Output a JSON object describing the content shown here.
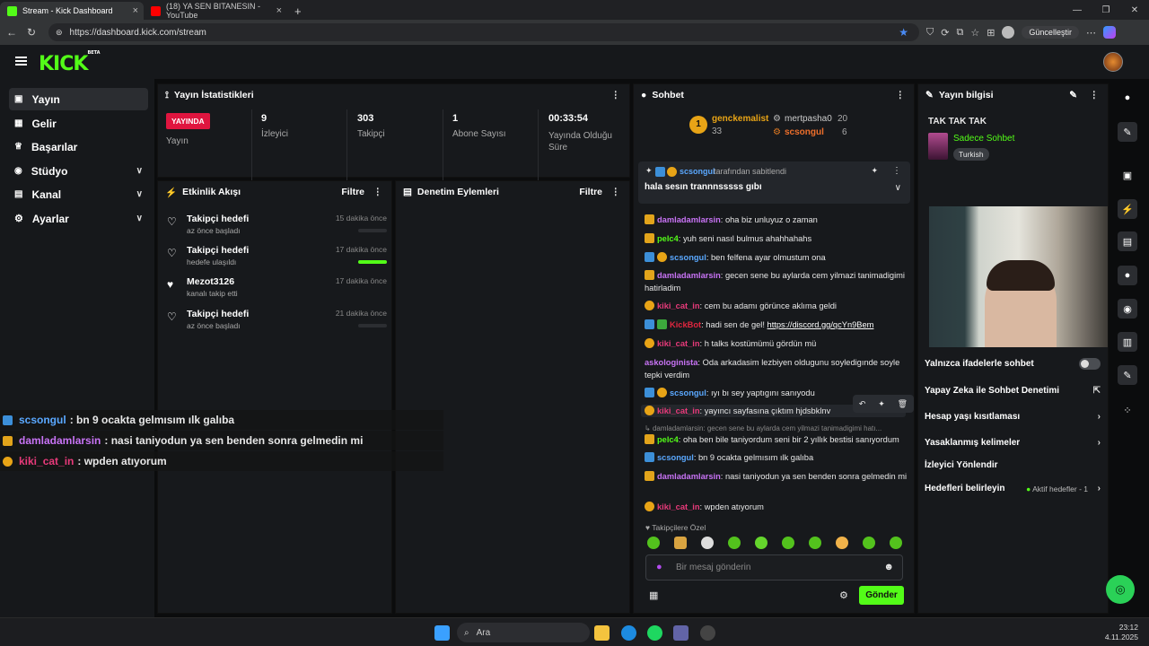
{
  "browser": {
    "tabs": [
      {
        "title": "Stream - Kick Dashboard"
      },
      {
        "title": "(18) YA SEN BITANESIN - YouTube"
      }
    ],
    "url": "https://dashboard.kick.com/stream",
    "update_label": "Güncelleştir"
  },
  "app": {
    "logo": "KICK",
    "logo_badge": "BETA"
  },
  "sidebar": {
    "items": [
      {
        "label": "Yayın",
        "icon": "broadcast-icon"
      },
      {
        "label": "Gelir",
        "icon": "revenue-icon"
      },
      {
        "label": "Başarılar",
        "icon": "trophy-icon"
      },
      {
        "label": "Stüdyo",
        "icon": "studio-icon"
      },
      {
        "label": "Kanal",
        "icon": "channel-icon"
      },
      {
        "label": "Ayarlar",
        "icon": "gear-icon"
      }
    ]
  },
  "stats": {
    "title": "Yayın İstatistikleri",
    "live_badge": "YAYINDA",
    "live_label": "Yayın",
    "viewers_value": "9",
    "viewers_label": "İzleyici",
    "followers_value": "303",
    "followers_label": "Takipçi",
    "subs_value": "1",
    "subs_label": "Abone Sayısı",
    "uptime_value": "00:33:54",
    "uptime_label": "Yayında Olduğu Süre"
  },
  "activity": {
    "title": "Etkinlik Akışı",
    "filter": "Filtre",
    "items": [
      {
        "title": "Takipçi hedefi",
        "sub": "az önce başladı",
        "time": "15 dakika önce",
        "progress": 0.0
      },
      {
        "title": "Takipçi hedefi",
        "sub": "hedefe ulaşıldı",
        "time": "17 dakika önce",
        "progress": 1.0
      },
      {
        "title": "Mezot3126",
        "sub": "kanalı takip etti",
        "time": "17 dakika önce"
      },
      {
        "title": "Takipçi hedefi",
        "sub": "az önce başladı",
        "time": "21 dakika önce",
        "progress": 0.0
      }
    ]
  },
  "moderation": {
    "title": "Denetim Eylemleri",
    "filter": "Filtre"
  },
  "chat": {
    "title": "Sohbet",
    "top1_name": "genckemalist",
    "top1_val": "33",
    "top2_name": "mertpasha0",
    "top2_val": "20",
    "top3_name": "scsongul",
    "top3_val": "6",
    "pinned_by": "scsongul",
    "pinned_suffix": "tarafından sabitlendi",
    "pinned_text": "hala sesın trannnsssss gıbı",
    "messages": [
      {
        "user": "damladamlarsin",
        "text": ": oha biz unluyuz o zaman",
        "color": "#c873f5"
      },
      {
        "user": "pelc4",
        "text": ": yuh seni nasıl bulmus ahahhahahs",
        "color": "#53fc18"
      },
      {
        "user": "scsongul",
        "text": ": ben felfena ayar olmustum ona",
        "color": "#5aa8ff"
      },
      {
        "user": "damladamlarsin",
        "text": ": gecen sene bu aylarda cem yilmazi tanimadigimi hatirladim",
        "color": "#c873f5"
      },
      {
        "user": "kiki_cat_in",
        "text": ": cem bu adamı görünce aklıma geldi",
        "color": "#e83a7a"
      },
      {
        "user": "KickBot",
        "text": ": hadi sen de gel! ",
        "link": "https://discord.gg/qcYn9Bem",
        "color": "#e0263f"
      },
      {
        "user": "kiki_cat_in",
        "text": ": h talks kostümümü gördün mü",
        "color": "#e83a7a"
      },
      {
        "user": "askologinista",
        "text": ": Oda arkadasim lezbiyen oldugunu soyledigınde soyle tepki verdim",
        "color": "#c873f5"
      },
      {
        "user": "scsongul",
        "text": ": ıyı bı sey yaptıgını sanıyodu",
        "color": "#5aa8ff"
      },
      {
        "user": "kiki_cat_in",
        "text": ": yayıncı sayfasına çıktım hjdsbklnv",
        "color": "#e83a7a"
      },
      {
        "reply": "damladamlarsin: gecen sene bu aylarda cem yilmazi tanimadigimi hatı..."
      },
      {
        "user": "pelc4",
        "text": ": oha ben bile taniyordum seni bir 2 yıllık bestisi sanıyordum",
        "color": "#53fc18"
      },
      {
        "user": "scsongul",
        "text": ": bn 9 ocakta gelmısım ılk galıba",
        "color": "#5aa8ff"
      },
      {
        "user": "damladamlarsin",
        "text": ": nasi taniyodun ya sen benden sonra gelmedin mi",
        "color": "#c873f5"
      },
      {
        "user": "kiki_cat_in",
        "text": ": wpden atıyorum",
        "color": "#e83a7a"
      }
    ],
    "followers_only_label": "Takipçilere Özel",
    "input_placeholder": "Bir mesaj gönderin",
    "send_label": "Gönder"
  },
  "overlay": [
    {
      "user": "scsongul",
      "text": ": bn 9 ocakta gelmısım ılk galıba",
      "color": "#5aa8ff"
    },
    {
      "user": "damladamlarsin",
      "text": ": nasi taniyodun ya sen benden sonra gelmedin mi",
      "color": "#c873f5"
    },
    {
      "user": "kiki_cat_in",
      "text": ": wpden atıyorum",
      "color": "#e83a7a"
    }
  ],
  "stream_info": {
    "title": "Yayın bilgisi",
    "stream_title": "TAK TAK TAK",
    "category": "Sadece Sohbet",
    "language": "Turkish",
    "settings": [
      {
        "label": "Yalnızca ifadelerle sohbet"
      },
      {
        "label": "Yapay Zeka ile Sohbet Denetimi"
      },
      {
        "label": "Hesap yaşı kısıtlaması"
      },
      {
        "label": "Yasaklanmış kelimeler"
      },
      {
        "label": "İzleyici Yönlendir"
      },
      {
        "label": "Hedefleri belirleyin",
        "extra": "Aktif hedefler - 1"
      }
    ]
  },
  "taskbar": {
    "search": "Ara",
    "time": "23:12",
    "date": "4.11.2025"
  }
}
